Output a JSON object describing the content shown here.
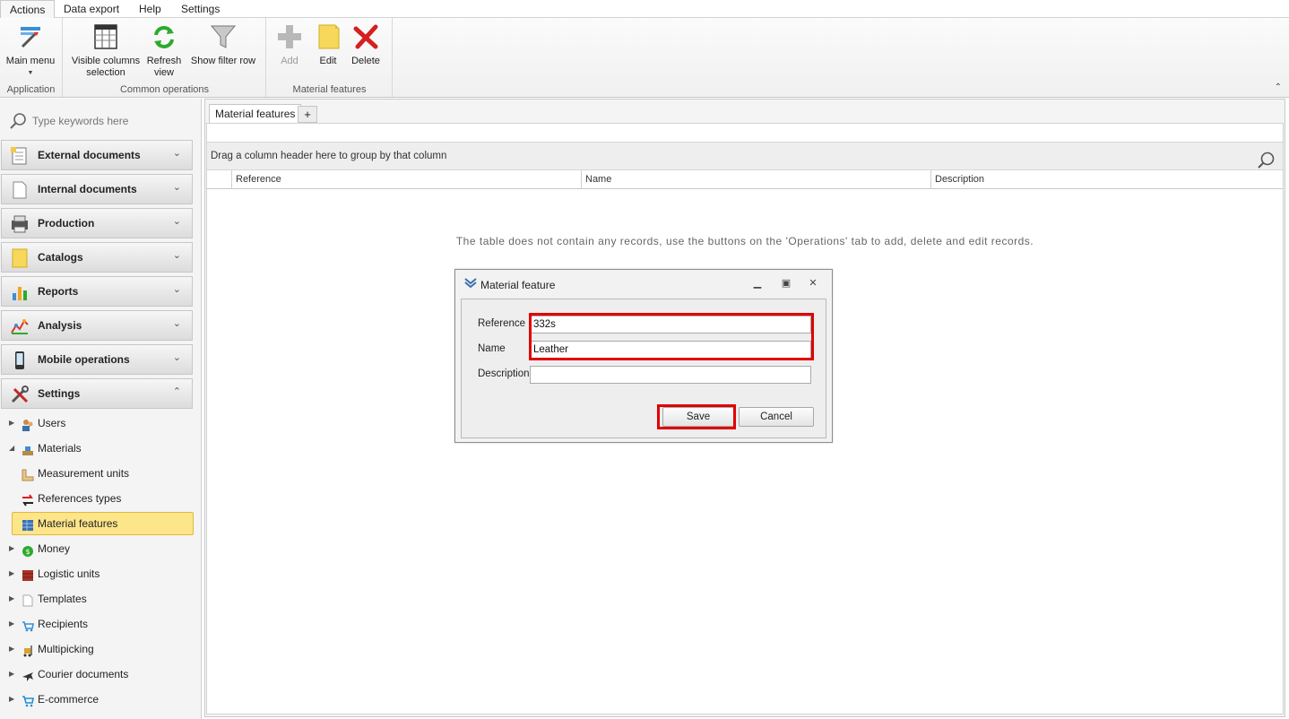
{
  "menubar": {
    "tabs": [
      "Actions",
      "Data export",
      "Help",
      "Settings"
    ]
  },
  "ribbon": {
    "groups": {
      "application": "Application",
      "common": "Common operations",
      "material": "Material features"
    },
    "buttons": {
      "main_menu": "Main menu",
      "visible_columns_line1": "Visible columns",
      "visible_columns_line2": "selection",
      "refresh_line1": "Refresh",
      "refresh_line2": "view",
      "filter_row": "Show filter row",
      "add": "Add",
      "edit": "Edit",
      "delete": "Delete"
    },
    "collapse_icon": "chevron-up-icon"
  },
  "sidebar": {
    "search_placeholder": "Type keywords here",
    "groups": [
      {
        "label": "External documents",
        "icon": "document-list-icon"
      },
      {
        "label": "Internal documents",
        "icon": "blank-document-icon"
      },
      {
        "label": "Production",
        "icon": "printer-icon"
      },
      {
        "label": "Catalogs",
        "icon": "catalog-icon"
      },
      {
        "label": "Reports",
        "icon": "bar-chart-icon"
      },
      {
        "label": "Analysis",
        "icon": "analysis-chart-icon"
      },
      {
        "label": "Mobile operations",
        "icon": "mobile-device-icon"
      },
      {
        "label": "Settings",
        "icon": "tools-icon"
      }
    ],
    "tree": [
      {
        "label": "Users",
        "icon": "users-icon"
      },
      {
        "label": "Materials",
        "icon": "materials-icon"
      },
      {
        "label": "Measurement units",
        "icon": "ruler-icon"
      },
      {
        "label": "References types",
        "icon": "references-icon"
      },
      {
        "label": "Material features",
        "icon": "table-icon"
      },
      {
        "label": "Money",
        "icon": "money-bag-icon"
      },
      {
        "label": "Logistic units",
        "icon": "pallet-icon"
      },
      {
        "label": "Templates",
        "icon": "template-icon"
      },
      {
        "label": "Recipients",
        "icon": "recipients-icon"
      },
      {
        "label": "Multipicking",
        "icon": "forklift-icon"
      },
      {
        "label": "Courier documents",
        "icon": "airplane-icon"
      },
      {
        "label": "E-commerce",
        "icon": "cart-icon"
      }
    ]
  },
  "main": {
    "tab_label": "Material features",
    "add_tab": "+",
    "group_panel_text": "Drag a column header here to group by that column",
    "columns": [
      "Reference",
      "Name",
      "Description"
    ],
    "empty_message": "The table does not contain any records, use the buttons on the 'Operations' tab to add, delete and edit records."
  },
  "dialog": {
    "title": "Material feature",
    "fields": {
      "reference_label": "Reference",
      "reference_value": "332s",
      "name_label": "Name",
      "name_value": "Leather",
      "description_label": "Description",
      "description_value": ""
    },
    "save_label": "Save",
    "cancel_label": "Cancel",
    "highlight_color": "#e00000"
  },
  "colors": {
    "selected_item_bg": "#fde58a",
    "selected_item_border": "#e0b93a"
  }
}
